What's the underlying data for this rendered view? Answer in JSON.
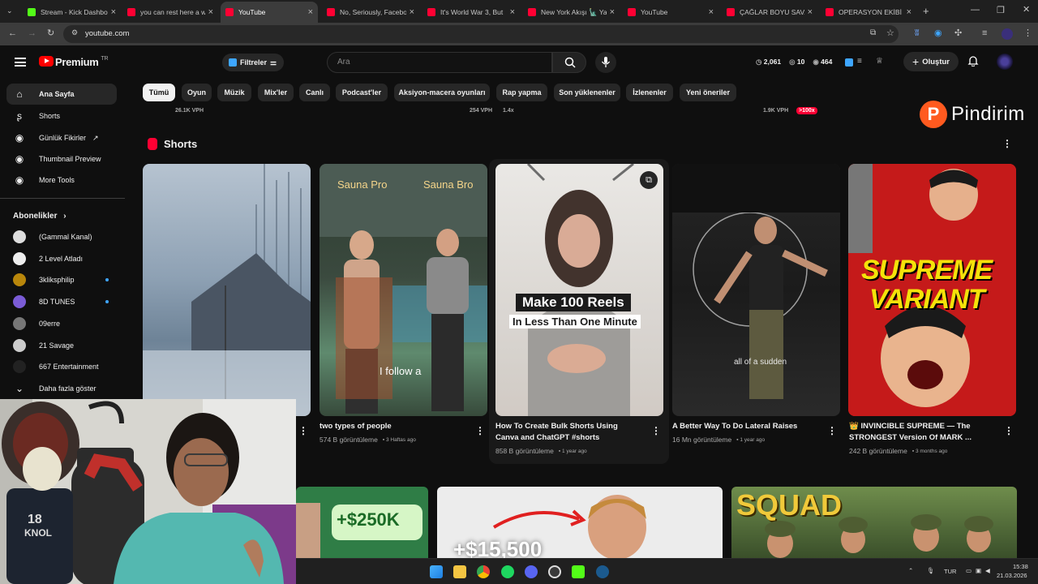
{
  "browser": {
    "tabs": [
      {
        "title": "Stream - Kick Dashbo",
        "color": "#53fc18",
        "active": false
      },
      {
        "title": "you can rest here a w",
        "color": "#ff0033",
        "active": false
      },
      {
        "title": "YouTube",
        "color": "#ff0033",
        "active": true
      },
      {
        "title": "No, Seriously, Facebo",
        "color": "#ff0033",
        "active": false
      },
      {
        "title": "It's World War 3, But",
        "color": "#ff0033",
        "active": false
      },
      {
        "title": "New York Akışı 🗽 Ya",
        "color": "#ff0033",
        "active": false
      },
      {
        "title": "YouTube",
        "color": "#ff0033",
        "active": false
      },
      {
        "title": "ÇAĞLAR BOYU SAVA",
        "color": "#ff0033",
        "active": false
      },
      {
        "title": "OPERASYON EKİBİ S/",
        "color": "#ff0033",
        "active": false
      }
    ],
    "url": "youtube.com"
  },
  "header": {
    "brand": "Premium",
    "region": "TR",
    "filter_label": "Filtreler",
    "search_placeholder": "Ara",
    "stat_views": "2,061",
    "stat_a": "10",
    "stat_b": "464",
    "create_label": "Oluştur"
  },
  "sidebar": {
    "items": [
      {
        "label": "Ana Sayfa",
        "icon": "home-icon",
        "selected": true
      },
      {
        "label": "Shorts",
        "icon": "shorts-icon",
        "selected": false
      },
      {
        "label": "Günlük Fikirler",
        "icon": "extension-icon",
        "selected": false
      },
      {
        "label": "Thumbnail Preview",
        "icon": "extension-icon",
        "selected": false
      },
      {
        "label": "More Tools",
        "icon": "extension-icon",
        "selected": false
      }
    ],
    "subs_heading": "Abonelikler",
    "subscriptions": [
      {
        "name": "(Gammal Kanal)",
        "color": "#ddd",
        "dot": false
      },
      {
        "name": "2 Level Atladı",
        "color": "#eee",
        "dot": false
      },
      {
        "name": "3kliksphilip",
        "color": "#b8860b",
        "dot": true
      },
      {
        "name": "8D TUNES",
        "color": "#7b5cd6",
        "dot": true
      },
      {
        "name": "09erre",
        "color": "#777",
        "dot": false
      },
      {
        "name": "21 Savage",
        "color": "#ccc",
        "dot": false
      },
      {
        "name": "667 Entertainment",
        "color": "#222",
        "dot": false
      }
    ],
    "show_more": "Daha fazla göster"
  },
  "chips": [
    "Tümü",
    "Oyun",
    "Müzik",
    "Mix'ler",
    "Canlı",
    "Podcast'ler",
    "Aksiyon-macera oyunları",
    "Rap yapma",
    "Son yüklenenler",
    "İzlenenler",
    "Yeni öneriler"
  ],
  "vph": {
    "a": "26.1K VPH",
    "b": "254 VPH",
    "b_mult": "1.4x",
    "c": "1.9K VPH",
    "c_mult": ">100x"
  },
  "watermark": "Pindirim",
  "shorts": {
    "heading": "Shorts",
    "items": [
      {
        "title": "",
        "views": "",
        "age": ""
      },
      {
        "title": "two types of people",
        "views": "574 B görüntüleme",
        "age": "3 Haftas ago",
        "overlay_a": "Sauna Pro",
        "overlay_b": "Sauna Bro",
        "overlay_c": "I follow a"
      },
      {
        "title": "How To Create Bulk Shorts Using Canva and ChatGPT #shorts",
        "views": "858 B görüntüleme",
        "age": "1 year ago",
        "overlay_a": "Make 100 Reels",
        "overlay_b": "In Less Than One Minute"
      },
      {
        "title": "A Better Way To Do Lateral Raises",
        "views": "16 Mn görüntüleme",
        "age": "1 year ago",
        "overlay_a": "all of a sudden"
      },
      {
        "title": "👑 INVINCIBLE SUPREME — The STRONGEST Version Of MARK ...",
        "views": "242 B görüntüleme",
        "age": "3 months ago",
        "overlay_a": "SUPREME",
        "overlay_b": "VARIANT"
      }
    ]
  },
  "bottom_row": {
    "thumb_a": "+$250K",
    "thumb_b": "+$15,500",
    "thumb_c": "SQUAD"
  },
  "taskbar": {
    "lang": "TUR",
    "time": "15:38",
    "date": "21.03.2026"
  },
  "webcam": {
    "jersey_text": "KNOL",
    "jersey_number": "18"
  }
}
